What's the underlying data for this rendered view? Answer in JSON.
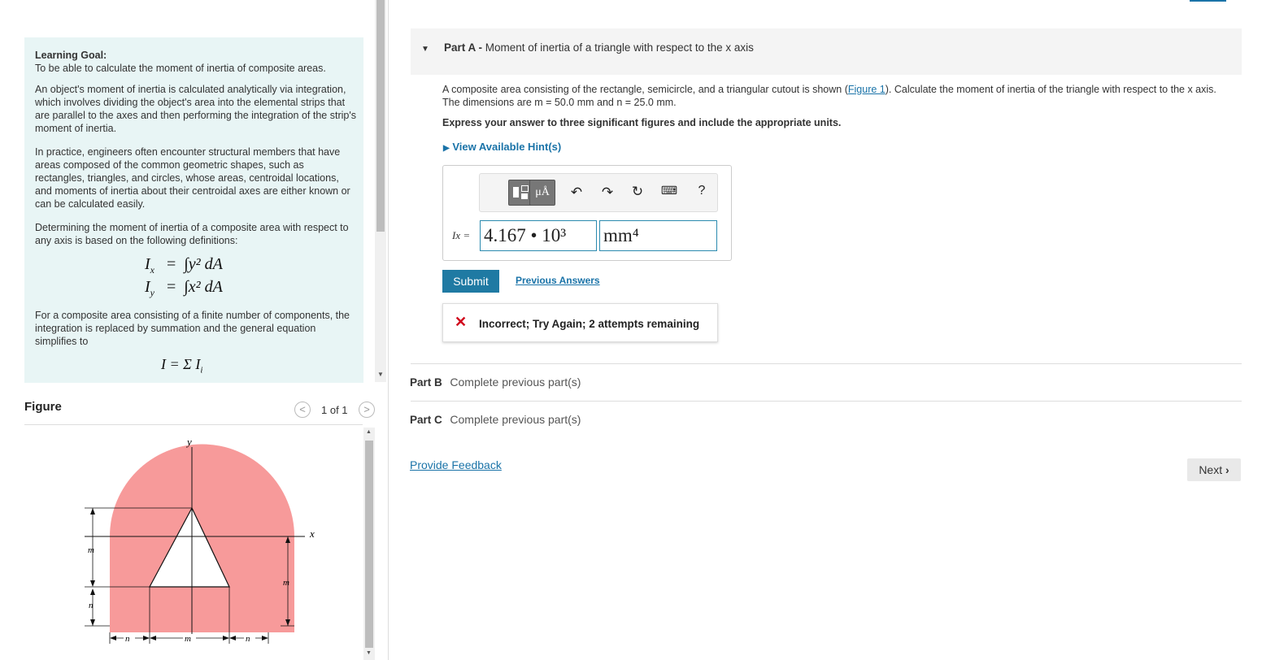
{
  "goal": {
    "heading": "Learning Goal:",
    "line1": "To be able to calculate the moment of inertia of composite areas.",
    "para1": "An object's moment of inertia is calculated analytically via integration, which involves dividing the object's area into the elemental strips that are parallel to the axes and then performing the integration of the strip's moment of inertia.",
    "para2": "In practice, engineers often encounter structural members that have areas composed of the common geometric shapes, such as rectangles, triangles, and circles, whose areas, centroidal locations, and moments of inertia about their centroidal axes are either known or can be calculated easily.",
    "para3": "Determining the moment of inertia of a composite area with respect to any axis is based on the following definitions:",
    "eq1_lhs": "I",
    "eq1_sub": "x",
    "eq1_rhs": "∫y² dA",
    "eq2_lhs": "I",
    "eq2_sub": "y",
    "eq2_rhs": "∫x² dA",
    "para4": "For a composite area consisting of a finite number of components, the integration is replaced by summation and the general equation simplifies to",
    "eq3": "I = Σ I"
  },
  "figure": {
    "title": "Figure",
    "pager": "1 of 1",
    "labels": {
      "y": "y",
      "x": "x",
      "m": "m",
      "n": "n"
    },
    "shape_color": "#f79a9a"
  },
  "partA": {
    "label": "Part A",
    "sep": " - ",
    "title": "Moment of inertia of a triangle with respect to the x axis",
    "q1": "A composite area consisting of the rectangle, semicircle, and a triangular cutout is shown (",
    "fig_link": "Figure 1",
    "q2": "). Calculate the moment of inertia of the triangle with respect to the x axis. The dimensions are m = 50.0 mm and n = 25.0 mm.",
    "instr": "Express your answer to three significant figures and include the appropriate units.",
    "hint": "View Available Hint(s)",
    "answer_label": "Ix =",
    "answer_value": "4.167 • 10³",
    "answer_units": "mm⁴",
    "submit": "Submit",
    "previous": "Previous Answers",
    "feedback": "Incorrect; Try Again; 2 attempts remaining",
    "toolbar": {
      "templates_icon": "templates-icon",
      "units_button": "μÅ",
      "undo_icon": "undo-icon",
      "redo_icon": "redo-icon",
      "reset_icon": "reset-icon",
      "keyboard_icon": "keyboard-icon",
      "help": "?"
    }
  },
  "partB": {
    "label": "Part B",
    "text": "Complete previous part(s)"
  },
  "partC": {
    "label": "Part C",
    "text": "Complete previous part(s)"
  },
  "provide_feedback": "Provide Feedback",
  "next": "Next"
}
